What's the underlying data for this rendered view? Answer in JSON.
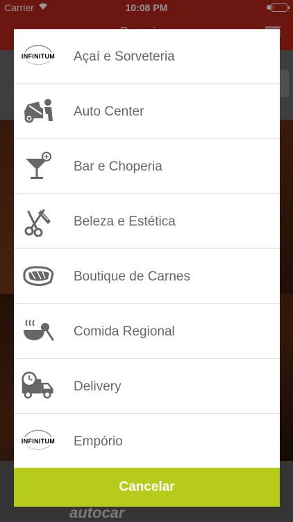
{
  "status_bar": {
    "carrier": "Carrier",
    "time": "10:08 PM"
  },
  "nav": {
    "title": "Parceiros"
  },
  "modal": {
    "items": [
      {
        "label": "Açaí e Sorveteria",
        "icon": "infinitum-logo-icon",
        "logo_text": "INFINITUM"
      },
      {
        "label": "Auto Center",
        "icon": "car-mechanic-icon"
      },
      {
        "label": "Bar e Choperia",
        "icon": "cocktail-icon"
      },
      {
        "label": "Beleza e Estética",
        "icon": "scissors-comb-icon"
      },
      {
        "label": "Boutique de Carnes",
        "icon": "steak-icon"
      },
      {
        "label": "Comida Regional",
        "icon": "soup-bowl-icon"
      },
      {
        "label": "Delivery",
        "icon": "delivery-truck-icon"
      },
      {
        "label": "Empório",
        "icon": "infinitum-logo-icon",
        "logo_text": "INFINITUM"
      }
    ],
    "cancel_label": "Cancelar"
  },
  "background": {
    "bottom_logo": "autocar"
  },
  "colors": {
    "primary": "#b8271d",
    "accent": "#b6cb1a",
    "icon": "#666666",
    "text": "#666666"
  }
}
